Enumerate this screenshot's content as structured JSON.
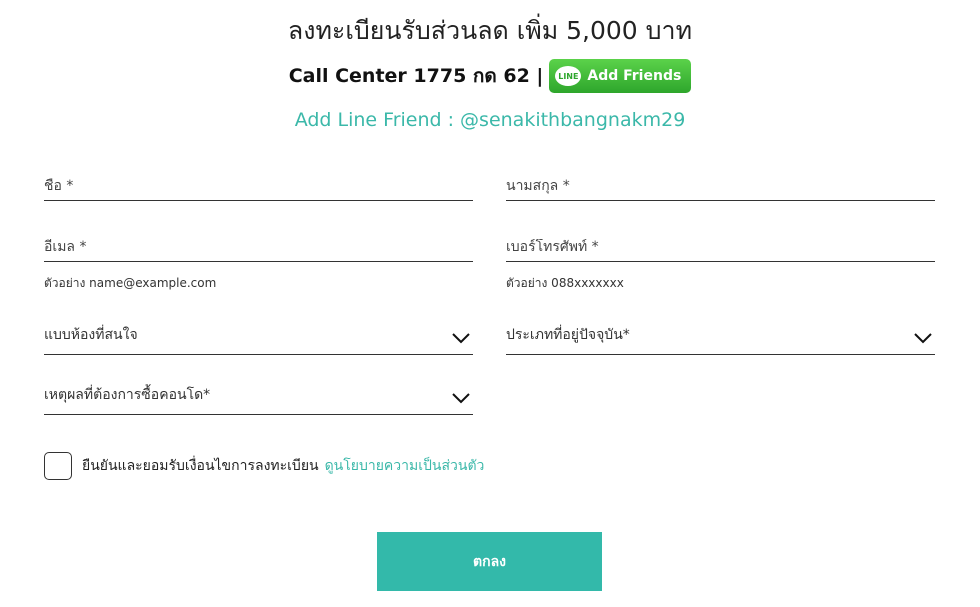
{
  "header": {
    "title": "ลงทะเบียนรับส่วนลด เพิ่ม 5,000 บาท",
    "call_center": "Call Center 1775 กด 62 |",
    "line_button": {
      "icon_text": "LINE",
      "label": "Add Friends"
    },
    "line_friend": "Add Line Friend : @senakithbangnakm29"
  },
  "form": {
    "first_name": {
      "placeholder": "ชื่อ *",
      "value": ""
    },
    "last_name": {
      "placeholder": "นามสกุล *",
      "value": ""
    },
    "email": {
      "placeholder": "อีเมล *",
      "value": "",
      "hint": "ตัวอย่าง name@example.com"
    },
    "phone": {
      "placeholder": "เบอร์โทรศัพท์ *",
      "value": "",
      "hint": "ตัวอย่าง 088xxxxxxx"
    },
    "room_type": {
      "label": "แบบห้องที่สนใจ",
      "icon": "chevron-down-icon"
    },
    "residence_type": {
      "label": "ประเภทที่อยู่ปัจจุบัน*",
      "icon": "chevron-down-icon"
    },
    "purchase_reason": {
      "label": "เหตุผลที่ต้องการซื้อคอนโด*",
      "icon": "chevron-down-icon"
    },
    "consent": {
      "checked": false,
      "text": "ยืนยันและยอมรับเงื่อนไขการลงทะเบียน",
      "link": "ดูนโยบายความเป็นส่วนตัว"
    },
    "submit_label": "ตกลง"
  },
  "colors": {
    "accent": "#33b9aa",
    "line_green": "#2ea62c",
    "text": "#222222"
  }
}
